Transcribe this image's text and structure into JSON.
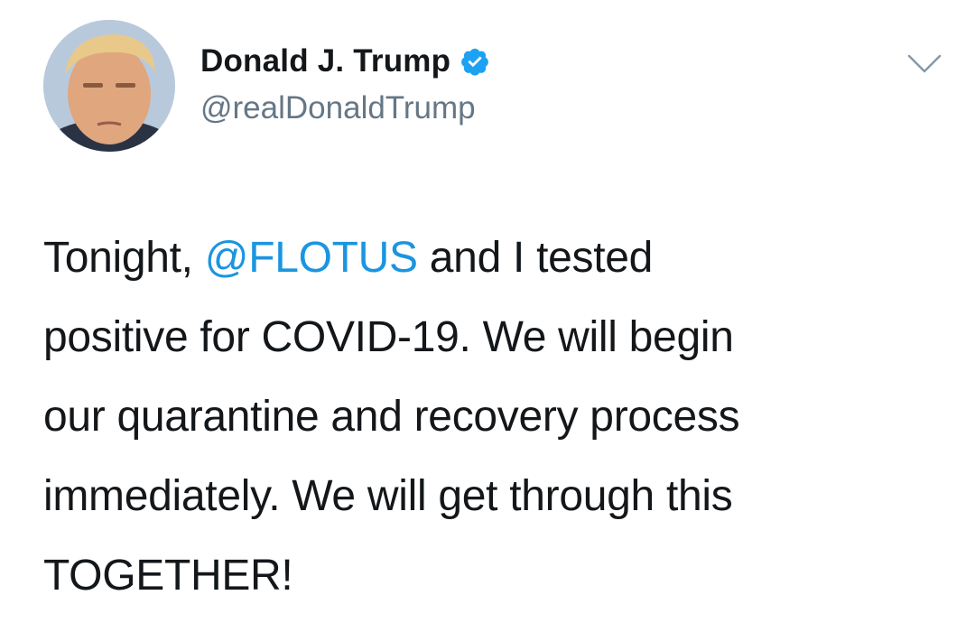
{
  "author": {
    "display_name": "Donald J. Trump",
    "handle": "@realDonaldTrump",
    "verified": true,
    "verified_icon": "verified-badge-icon",
    "verified_color": "#1da1f2",
    "avatar_icon": "profile-photo"
  },
  "menu": {
    "icon": "chevron-down-icon"
  },
  "tweet": {
    "text_before_mention": "Tonight, ",
    "mention": "@FLOTUS",
    "mention_color": "#1b95e0",
    "line1_after_mention": " and I tested",
    "line2": "positive for COVID-19. We will begin",
    "line3": "our quarantine and recovery process",
    "line4": "immediately. We will get through this",
    "line5": "TOGETHER!"
  }
}
